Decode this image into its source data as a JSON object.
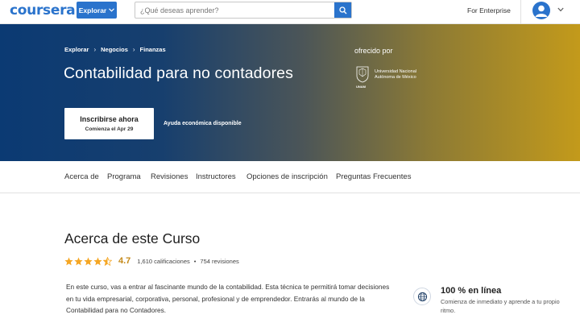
{
  "header": {
    "logo": "coursera",
    "explore_label": "Explorar",
    "search_placeholder": "¿Qué deseas aprender?",
    "enterprise_label": "For Enterprise",
    "icons": [
      "search-icon",
      "chevron-down-icon",
      "user-avatar-icon"
    ],
    "brand_color": "#2a73cc"
  },
  "hero": {
    "breadcrumb": [
      "Explorar",
      "Negocios",
      "Finanzas"
    ],
    "title": "Contabilidad para no contadores",
    "offered_by_label": "ofrecido por",
    "institution_line1": "Universidad Nacional",
    "institution_line2": "Autónoma de México",
    "institution_short": "UNAM",
    "enroll_label": "Inscribirse ahora",
    "enroll_sub": "Comienza el Apr 29",
    "financial_aid": "Ayuda económica disponible"
  },
  "tabs": [
    {
      "label": "Acerca de"
    },
    {
      "label": "Programa"
    },
    {
      "label": "Revisiones"
    },
    {
      "label": "Instructores"
    },
    {
      "label": "Opciones de inscripción"
    },
    {
      "label": "Preguntas Frecuentes"
    }
  ],
  "about": {
    "title": "Acerca de este Curso",
    "rating": "4.7",
    "stars": 4.7,
    "ratings_count": "1,610 calificaciones",
    "separator": "•",
    "reviews_count": "754 revisiones",
    "star_color": "#f5a623",
    "description": "En este curso, vas a entrar al  fascinante mundo de la contabilidad. Esta técnica te permitirá tomar decisiones en tu vida empresarial, corporativa, personal, profesional y de emprendedor. Entrarás al mundo de la Contabilidad para no Contadores.",
    "online_title": "100 % en línea",
    "online_sub": "Comienza de inmediato y aprende a tu propio ritmo."
  }
}
